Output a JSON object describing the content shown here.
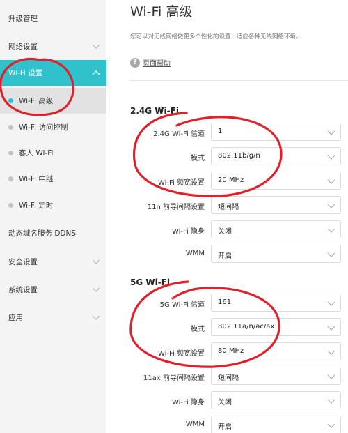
{
  "sidebar": {
    "items_top": [
      {
        "label": "升级管理"
      },
      {
        "label": "网络设置"
      }
    ],
    "active_group": {
      "label": "Wi-Fi 设置"
    },
    "sub_items": [
      {
        "label": "Wi-Fi 高级",
        "active": true
      },
      {
        "label": "Wi-Fi 访问控制",
        "active": false
      },
      {
        "label": "客人 Wi-Fi",
        "active": false
      },
      {
        "label": "Wi-Fi 中继",
        "active": false
      },
      {
        "label": "Wi-Fi 定时",
        "active": false
      }
    ],
    "items_bottom": [
      {
        "label": "动态域名服务 DDNS"
      },
      {
        "label": "安全设置"
      },
      {
        "label": "系统设置"
      },
      {
        "label": "应用"
      }
    ]
  },
  "main": {
    "title": "Wi-Fi 高级",
    "description": "您可以对无线网络做更多个性化的设置，适应各种无线网络环境。",
    "help_label": "页面帮助",
    "section_24": {
      "title": "2.4G Wi-Fi",
      "rows": [
        {
          "label": "2.4G Wi-Fi 信道",
          "value": "1"
        },
        {
          "label": "模式",
          "value": "802.11b/g/n"
        },
        {
          "label": "Wi-Fi 频宽设置",
          "value": "20 MHz"
        },
        {
          "label": "11n 前导间隔设置",
          "value": "短间隔"
        },
        {
          "label": "Wi-Fi 隐身",
          "value": "关闭"
        },
        {
          "label": "WMM",
          "value": "开启"
        }
      ]
    },
    "section_5": {
      "title": "5G Wi-Fi",
      "rows": [
        {
          "label": "5G Wi-Fi 信道",
          "value": "161"
        },
        {
          "label": "模式",
          "value": "802.11a/n/ac/ax"
        },
        {
          "label": "Wi-Fi 频宽设置",
          "value": "80 MHz"
        },
        {
          "label": "11ax 前导间隔设置",
          "value": "短间隔"
        },
        {
          "label": "Wi-Fi 隐身",
          "value": "关闭"
        },
        {
          "label": "WMM",
          "value": "开启"
        }
      ]
    }
  },
  "colors": {
    "accent": "#31c1cc",
    "annotation": "#e0202a"
  }
}
